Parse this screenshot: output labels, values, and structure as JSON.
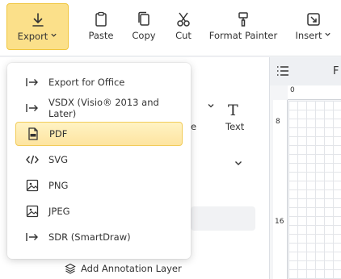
{
  "toolbar": {
    "export_label": "Export",
    "paste_label": "Paste",
    "copy_label": "Copy",
    "cut_label": "Cut",
    "format_painter_label": "Format Painter",
    "insert_label": "Insert"
  },
  "export_menu": {
    "items": [
      {
        "label": "Export for Office",
        "icon": "export-arrow-icon"
      },
      {
        "label": "VSDX (Visio® 2013 and Later)",
        "icon": "export-arrow-icon"
      },
      {
        "label": "PDF",
        "icon": "pdf-file-icon",
        "selected": true
      },
      {
        "label": "SVG",
        "icon": "code-icon"
      },
      {
        "label": "PNG",
        "icon": "image-icon"
      },
      {
        "label": "JPEG",
        "icon": "image-icon"
      },
      {
        "label": "SDR (SmartDraw)",
        "icon": "export-arrow-icon"
      }
    ]
  },
  "panel": {
    "text_tool_label": "Text",
    "text_tool_icon": "T",
    "partial_label": "e",
    "add_annotation_layer": "Add Annotation Layer"
  },
  "canvas": {
    "header_char": "F",
    "ruler_top_label": "0",
    "ruler_left_labels": [
      "8",
      "16"
    ]
  },
  "colors": {
    "export_bg": "#fbe08a",
    "selected_item_bg": "#fde4a0",
    "selected_item_border": "#f2cc5a"
  }
}
